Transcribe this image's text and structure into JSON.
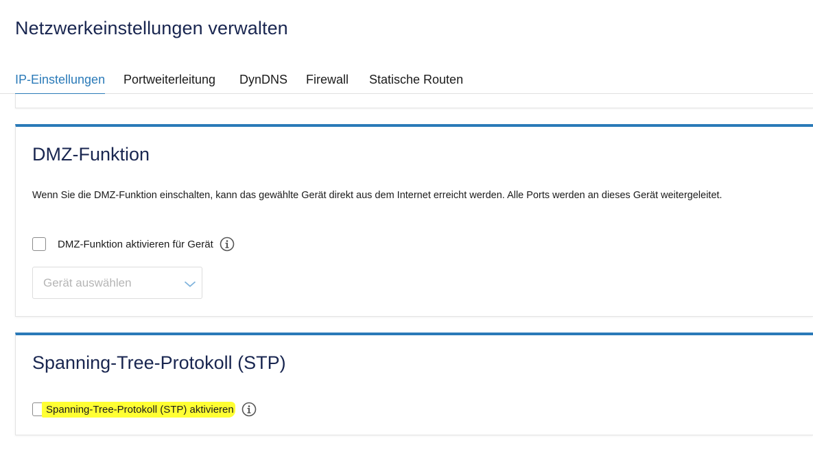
{
  "page": {
    "title": "Netzwerkeinstellungen verwalten"
  },
  "tabs": [
    {
      "label": "IP-Einstellungen",
      "active": true
    },
    {
      "label": "Portweiterleitung",
      "active": false
    },
    {
      "label": "DynDNS",
      "active": false
    },
    {
      "label": "Firewall",
      "active": false
    },
    {
      "label": "Statische Routen",
      "active": false
    }
  ],
  "dmz": {
    "title": "DMZ-Funktion",
    "description": "Wenn Sie die DMZ-Funktion einschalten, kann das gewählte Gerät direkt aus dem Internet erreicht werden. Alle Ports werden an dieses Gerät weitergeleitet.",
    "checkbox_label": "DMZ-Funktion aktivieren für Gerät",
    "checked": false,
    "select_placeholder": "Gerät auswählen",
    "info_icon": "info-circle-icon"
  },
  "stp": {
    "title": "Spanning-Tree-Protokoll (STP)",
    "checkbox_label": "Spanning-Tree-Protokoll (STP) aktivieren",
    "checked": false,
    "info_icon": "info-circle-icon"
  },
  "colors": {
    "accent": "#2a7ab8",
    "title": "#192650",
    "highlight": "#ffff33"
  }
}
